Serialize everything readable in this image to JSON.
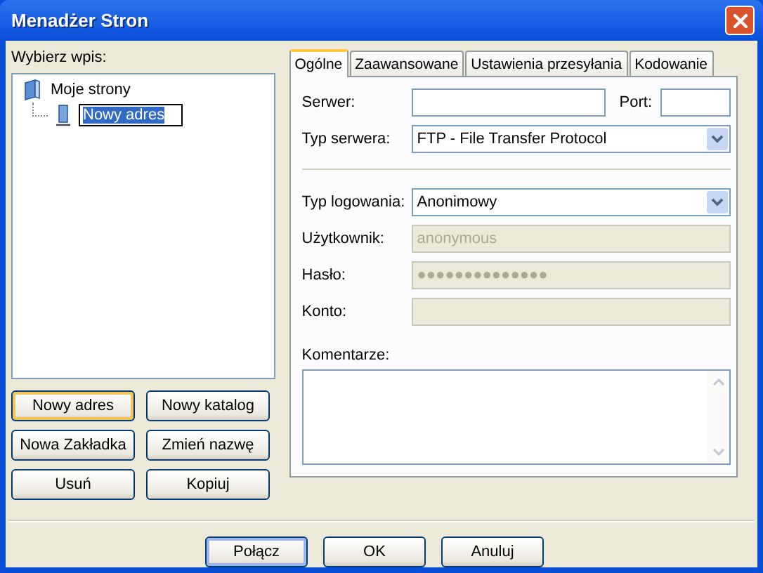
{
  "window": {
    "title": "Menadżer Stron"
  },
  "tree": {
    "label": "Wybierz wpis:",
    "items": [
      {
        "label": "Moje strony",
        "kind": "folder",
        "selected": false,
        "children": [
          {
            "label": "Nowy adres",
            "kind": "site",
            "selected": true
          }
        ]
      }
    ]
  },
  "site_buttons": [
    {
      "label": "Nowy adres",
      "focused": true
    },
    {
      "label": "Nowy katalog",
      "focused": false
    },
    {
      "label": "Nowa Zakładka",
      "focused": false
    },
    {
      "label": "Zmień nazwę",
      "focused": false
    },
    {
      "label": "Usuń",
      "focused": false
    },
    {
      "label": "Kopiuj",
      "focused": false
    }
  ],
  "tabs": [
    {
      "label": "Ogólne",
      "selected": true
    },
    {
      "label": "Zaawansowane",
      "selected": false
    },
    {
      "label": "Ustawienia przesyłania",
      "selected": false
    },
    {
      "label": "Kodowanie",
      "selected": false
    }
  ],
  "rows": [
    {
      "kind": "host",
      "label": "Serwer:",
      "port_label": "Port:"
    },
    {
      "kind": "select",
      "label": "Typ serwera:",
      "value": "FTP - File Transfer Protocol"
    },
    {
      "kind": "separator"
    },
    {
      "kind": "select",
      "label": "Typ logowania:",
      "value": "Anonimowy"
    },
    {
      "kind": "text",
      "label": "Użytkownik:",
      "value": "anonymous",
      "disabled": true
    },
    {
      "kind": "text",
      "label": "Hasło:",
      "value": "●●●●●●●●●●●●●●",
      "disabled": true
    },
    {
      "kind": "text",
      "label": "Konto:",
      "disabled": true
    }
  ],
  "comments": {
    "label": "Komentarze:"
  },
  "dialog_buttons": [
    {
      "label": "Połącz",
      "default": true
    },
    {
      "label": "OK",
      "default": false
    },
    {
      "label": "Anuluj",
      "default": false
    }
  ]
}
